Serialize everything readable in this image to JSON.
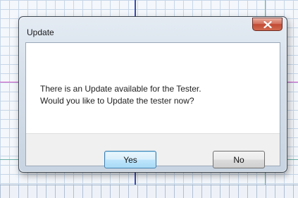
{
  "dialog": {
    "title": "Update",
    "message_lines": [
      "There is an Update available for the Tester.",
      "Would you like to Update the tester now?"
    ],
    "buttons": {
      "yes": "Yes",
      "no": "No"
    },
    "default_button": "yes"
  },
  "icons": {
    "close": "close-x-icon"
  },
  "colors": {
    "close_button": "#c9543d",
    "default_button_border": "#3c7fb1",
    "grid": "#c6d6e8",
    "guide_blue": "#3a4bb4",
    "guide_magenta": "#d255c8",
    "guide_teal": "#6db1a8"
  }
}
